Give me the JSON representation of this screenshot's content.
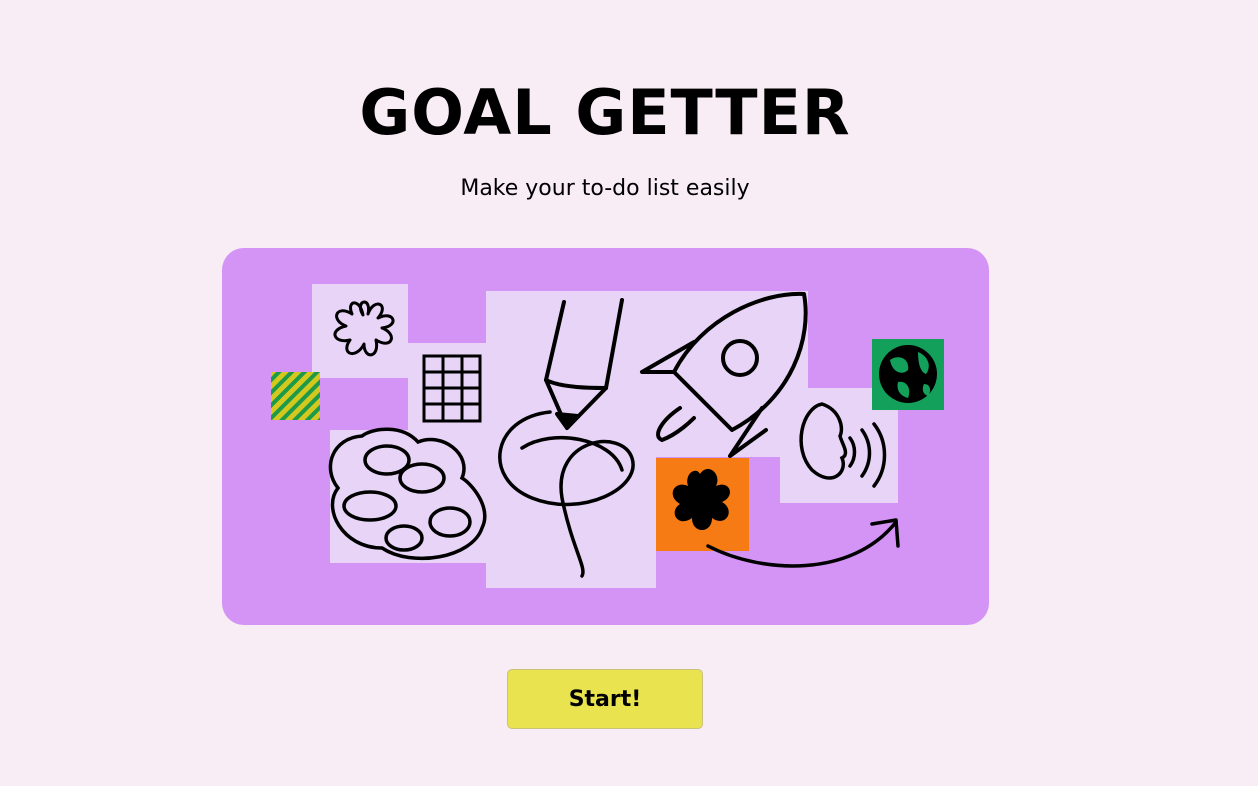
{
  "header": {
    "title": "GOAL GETTER",
    "subtitle": "Make your to-do list easily"
  },
  "hero": {
    "illustration": "doodle-collage",
    "icons": [
      "flower-icon",
      "striped-square-icon",
      "grid-icon",
      "pencil-icon",
      "rocket-icon",
      "globe-icon",
      "scribble-cloud-icon",
      "orange-blob-icon",
      "face-sound-icon",
      "arrow-icon"
    ]
  },
  "actions": {
    "start_label": "Start!"
  },
  "colors": {
    "background": "#f8ecf5",
    "hero_background": "#d394f5",
    "panel": "#e8d4f6",
    "button": "#e9e34f",
    "orange": "#f77b14",
    "green": "#12a05a",
    "stripe_yellow": "#d4c81f"
  }
}
